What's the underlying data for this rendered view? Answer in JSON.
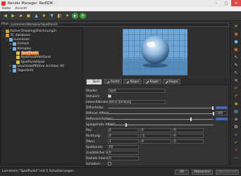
{
  "window": {
    "title": "Render Manager: RedSDK",
    "minimize": "–",
    "maximize": "□",
    "close": "✕"
  },
  "menu": {
    "items": [
      "Datei",
      "Ansicht"
    ]
  },
  "toolbar": {
    "icons": [
      "back-icon",
      "forward-icon",
      "folder-icon",
      "new-icon",
      "up-icon",
      "star-icon",
      "down-icon",
      "export-icon",
      "gear-icon",
      "play-icon",
      "add-icon"
    ]
  },
  "path": {
    "label": "Pfad",
    "value": "Lumienen\\Komplex\\SpotPunkt"
  },
  "tree": {
    "nodes": [
      {
        "label": "Active Drawing(Zeichnung2)",
        "level": 0,
        "expander": "−",
        "color": "#c9a13b"
      },
      {
        "label": "TC database",
        "level": 0,
        "expander": "−",
        "color": "#c9a13b"
      },
      {
        "label": "Lumienen",
        "level": 1,
        "expander": "−",
        "color": "#7ab0e0"
      },
      {
        "label": "Einfach",
        "level": 2,
        "expander": "+",
        "color": "#7ab0e0"
      },
      {
        "label": "Komplex",
        "level": 2,
        "expander": "−",
        "color": "#7ab0e0"
      },
      {
        "label": "SpotPunkt",
        "level": 3,
        "expander": "",
        "color": "#e0c040",
        "selected": true
      },
      {
        "label": "SpotPunktAbstand",
        "level": 3,
        "expander": "",
        "color": "#e0c040"
      },
      {
        "label": "SpotPunktSpot",
        "level": 3,
        "expander": "",
        "color": "#e0c040"
      },
      {
        "label": "LeuchtstoffRöhre Architec AV",
        "level": 2,
        "expander": "+",
        "color": "#7ab0e0"
      },
      {
        "label": "Tageslicht",
        "level": 2,
        "expander": "+",
        "color": "#7ab0e0"
      }
    ]
  },
  "tabs": [
    "Spot",
    "Punkt",
    "Kegel",
    "Kegel",
    "Kegel"
  ],
  "properties": {
    "shader_label": "Shader:",
    "shader_value": "Spot",
    "active_label": "Aktiviert:",
    "active_check": "✓",
    "intensity_label": "Intensitätsabsenkung:",
    "intensity_value": "Keine Senkung",
    "diffuse_color_label": "Diffusfarbe:",
    "diffuse_effect_label": "Diffuser Affekt:",
    "diffuse_effect_value": "100",
    "reflection_color_label": "Reflexionsfarben:",
    "mirror_effect_label": "Spiegelnder Affekt:",
    "pos_label": "Pos:",
    "pos_values": [
      "0",
      "0",
      "0"
    ],
    "dir_label": "Richtung:",
    "dir_values": [
      "0",
      "-1",
      "0"
    ],
    "up_label": "Oben:",
    "up_values": [
      "1",
      "0",
      "0"
    ],
    "spot_angle_label": "Spotkonus:",
    "spot_angle_value": "60",
    "extra_label": "Zusätzlicher Spotwinkel:",
    "extra_value": "0",
    "radial_label": "Radiale Intensitätssenkung:",
    "radial_value": "0",
    "shadows_label": "Schatten:"
  },
  "right_toolbar": {
    "icons": [
      "light-icon",
      "material-icon",
      "sphere-icon",
      "render-icon",
      "cursor-icon",
      "pen-icon",
      "arrow-icon",
      "close-icon",
      "pencil-icon",
      "brush-icon",
      "paint-icon",
      "fill-icon",
      "layer-icon",
      "settings-icon",
      "search-icon",
      "check-icon",
      "cancel-icon",
      "dots-icon"
    ]
  },
  "status": {
    "text": "Lumienen \"SpotPunkt\" mit 5 Schattierungen",
    "ok": "OK",
    "cancel": "Abbrechen",
    "apply": "Übernehmen"
  }
}
